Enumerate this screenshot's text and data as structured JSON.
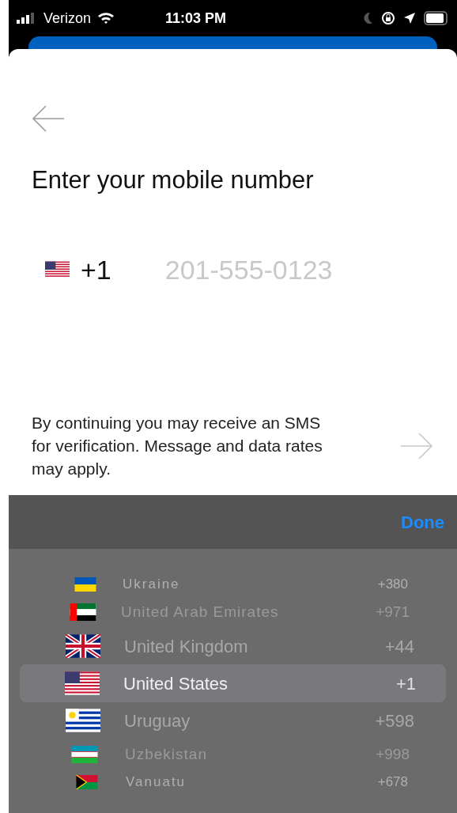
{
  "status_bar": {
    "carrier": "Verizon",
    "time": "11:03 PM"
  },
  "screen": {
    "title": "Enter your mobile number",
    "country_code": "+1",
    "phone_placeholder": "201-555-0123",
    "disclaimer": "By continuing you may receive an SMS for verification. Message and data rates may apply."
  },
  "picker": {
    "done": "Done",
    "countries": [
      {
        "name": "Ukraine",
        "code": "+380",
        "kind": "ua",
        "selected": false
      },
      {
        "name": "United Arab Emirates",
        "code": "+971",
        "kind": "ae",
        "selected": false
      },
      {
        "name": "United Kingdom",
        "code": "+44",
        "kind": "gb",
        "selected": false
      },
      {
        "name": "United States",
        "code": "+1",
        "kind": "us",
        "selected": true
      },
      {
        "name": "Uruguay",
        "code": "+598",
        "kind": "uy",
        "selected": false
      },
      {
        "name": "Uzbekistan",
        "code": "+998",
        "kind": "uz",
        "selected": false
      },
      {
        "name": "Vanuatu",
        "code": "+678",
        "kind": "vu",
        "selected": false
      }
    ]
  }
}
